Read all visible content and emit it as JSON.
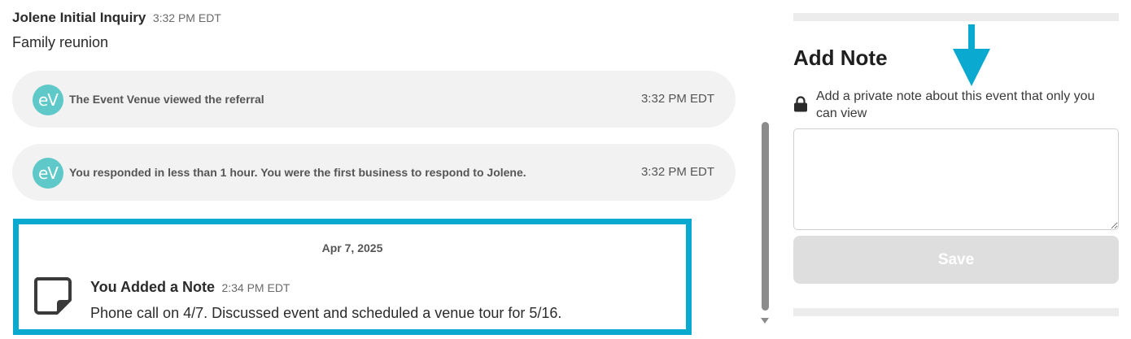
{
  "conversation": {
    "sender_name": "Jolene Initial Inquiry",
    "sender_time": "3:32 PM EDT",
    "subtitle": "Family reunion"
  },
  "activities": [
    {
      "avatar": "eV",
      "text": "The Event Venue viewed the referral",
      "time": "3:32 PM EDT"
    },
    {
      "avatar": "eV",
      "text": "You responded in less than 1 hour. You were the first business to respond to Jolene.",
      "time": "3:32 PM EDT"
    }
  ],
  "note_entry": {
    "date": "Apr 7, 2025",
    "icon": "note-icon",
    "title": "You Added a Note",
    "time": "2:34 PM EDT",
    "body": "Phone call on 4/7. Discussed event and scheduled a venue tour for 5/16."
  },
  "add_note_panel": {
    "title": "Add Note",
    "private_text": "Add a private note about this event that only you can view",
    "lock_icon": "lock-icon",
    "textarea_value": "",
    "save_label": "Save"
  },
  "colors": {
    "highlight": "#0aa9cf",
    "avatar": "#5ec9c8",
    "save_disabled": "#dedede"
  }
}
